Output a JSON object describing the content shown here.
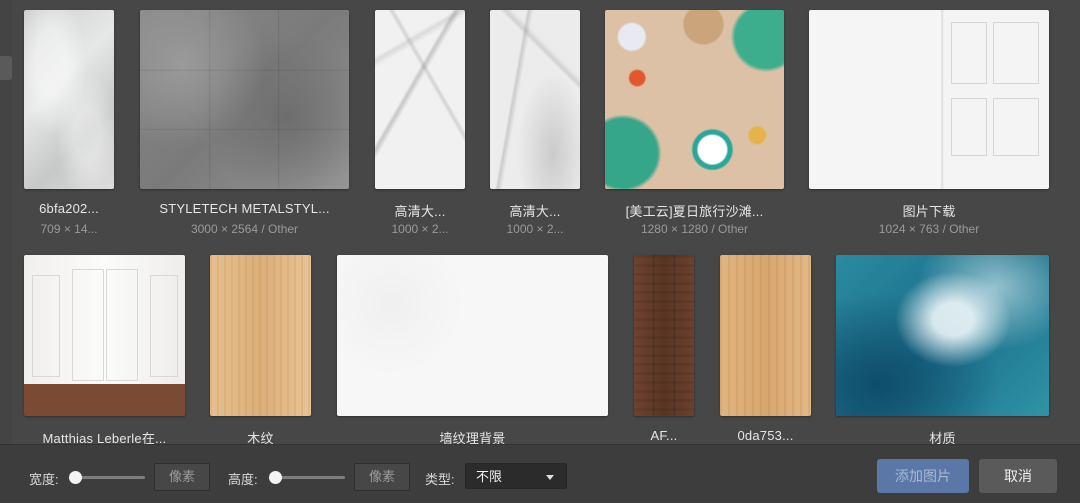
{
  "images": [
    {
      "name": "6bfa202...",
      "meta": "709 × 14..."
    },
    {
      "name": "STYLETECH METALSTYL...",
      "meta": "3000 × 2564 / Other"
    },
    {
      "name": "高清大...",
      "meta": "1000 × 2..."
    },
    {
      "name": "高清大...",
      "meta": "1000 × 2..."
    },
    {
      "name": "[美工云]夏日旅行沙滩...",
      "meta": "1280 × 1280 / Other"
    },
    {
      "name": "图片下载",
      "meta": "1024 × 763 / Other"
    },
    {
      "name": "Matthias Leberle在..."
    },
    {
      "name": "木纹"
    },
    {
      "name": "墙纹理背景"
    },
    {
      "name": "AF..."
    },
    {
      "name": "0da753..."
    },
    {
      "name": "材质"
    }
  ],
  "footer": {
    "width_label": "宽度:",
    "height_label": "高度:",
    "unit_label": "像素",
    "width_slider_value": 0,
    "height_slider_value": 0,
    "type_label": "类型:",
    "type_value": "不限",
    "add_label": "添加图片",
    "cancel_label": "取消"
  },
  "colors": {
    "primary": "#5a77a8",
    "background": "#4a4a4a",
    "bar": "#3d3d3d"
  }
}
